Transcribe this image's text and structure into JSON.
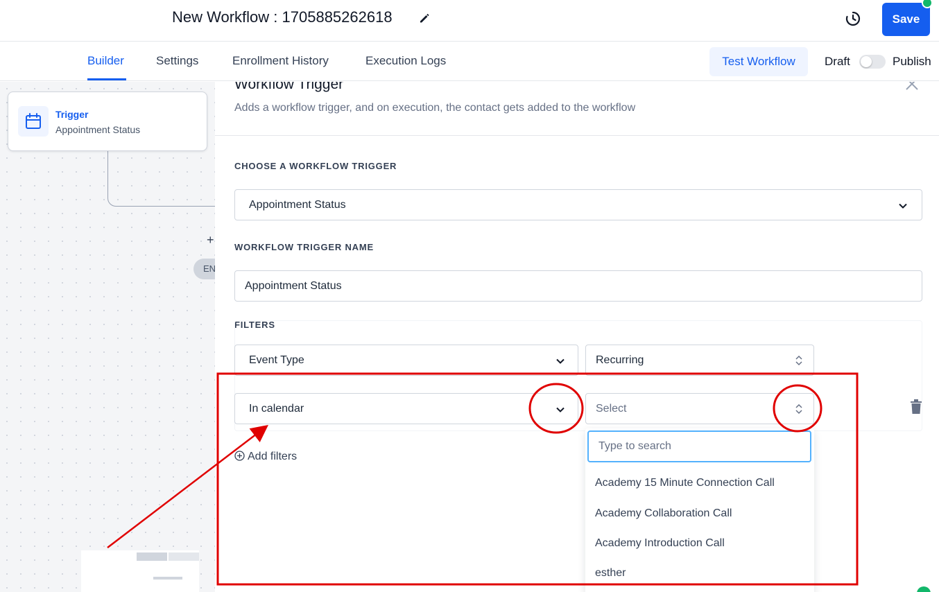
{
  "header": {
    "workflow_title": "New Workflow : 1705885262618",
    "save_label": "Save"
  },
  "tabs": [
    {
      "label": "Builder",
      "active": true
    },
    {
      "label": "Settings",
      "active": false
    },
    {
      "label": "Enrollment History",
      "active": false
    },
    {
      "label": "Execution Logs",
      "active": false
    }
  ],
  "toolbar": {
    "test_workflow_label": "Test Workflow",
    "draft_label": "Draft",
    "publish_label": "Publish"
  },
  "canvas": {
    "trigger_card": {
      "title": "Trigger",
      "subtitle": "Appointment Status"
    },
    "add_glyph": "+",
    "end_label": "EN"
  },
  "panel": {
    "title": "Workflow Trigger",
    "description": "Adds a workflow trigger, and on execution, the contact gets added to the workflow",
    "choose_trigger_label": "CHOOSE A WORKFLOW TRIGGER",
    "trigger_value": "Appointment Status",
    "trigger_name_label": "WORKFLOW TRIGGER NAME",
    "trigger_name_value": "Appointment Status",
    "filters_label": "FILTERS",
    "filters": [
      {
        "field": "Event Type",
        "value": "Recurring"
      },
      {
        "field": "In calendar",
        "value": "",
        "placeholder": "Select"
      }
    ],
    "add_filters_label": "Add filters"
  },
  "dropdown": {
    "search_placeholder": "Type to search",
    "options": [
      "Academy 15 Minute Connection Call",
      "Academy Collaboration Call",
      "Academy Introduction Call",
      "esther"
    ]
  },
  "colors": {
    "primary": "#155eef",
    "annotation_red": "#e00000",
    "success": "#12b76a"
  }
}
